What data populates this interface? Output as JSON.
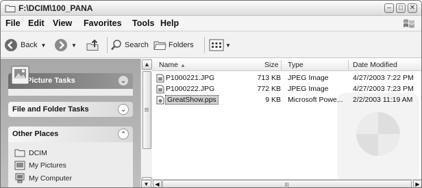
{
  "window": {
    "title": "F:\\DCIM\\100_PANA"
  },
  "menu": [
    "File",
    "Edit",
    "View",
    "Favorites",
    "Tools",
    "Help"
  ],
  "toolbar": {
    "back_label": "Back",
    "search_label": "Search",
    "folders_label": "Folders"
  },
  "tasks": {
    "picture_tasks": "Picture Tasks",
    "file_folder_tasks": "File and Folder Tasks",
    "other_places": "Other Places",
    "places": [
      "DCIM",
      "My Pictures",
      "My Computer"
    ]
  },
  "columns": {
    "name": "Name",
    "size": "Size",
    "type": "Type",
    "date": "Date Modified"
  },
  "files": [
    {
      "name": "P1000221.JPG",
      "size": "713 KB",
      "type": "JPEG Image",
      "date": "4/27/2003 7:22 PM",
      "icon": "image-file-icon"
    },
    {
      "name": "P1000222.JPG",
      "size": "772 KB",
      "type": "JPEG Image",
      "date": "4/27/2003 7:23 PM",
      "icon": "image-file-icon"
    },
    {
      "name": "GreatShow.pps",
      "size": "9 KB",
      "type": "Microsoft Powe...",
      "date": "2/2/2003 11:19 AM",
      "icon": "powerpoint-file-icon",
      "selected": true
    }
  ]
}
